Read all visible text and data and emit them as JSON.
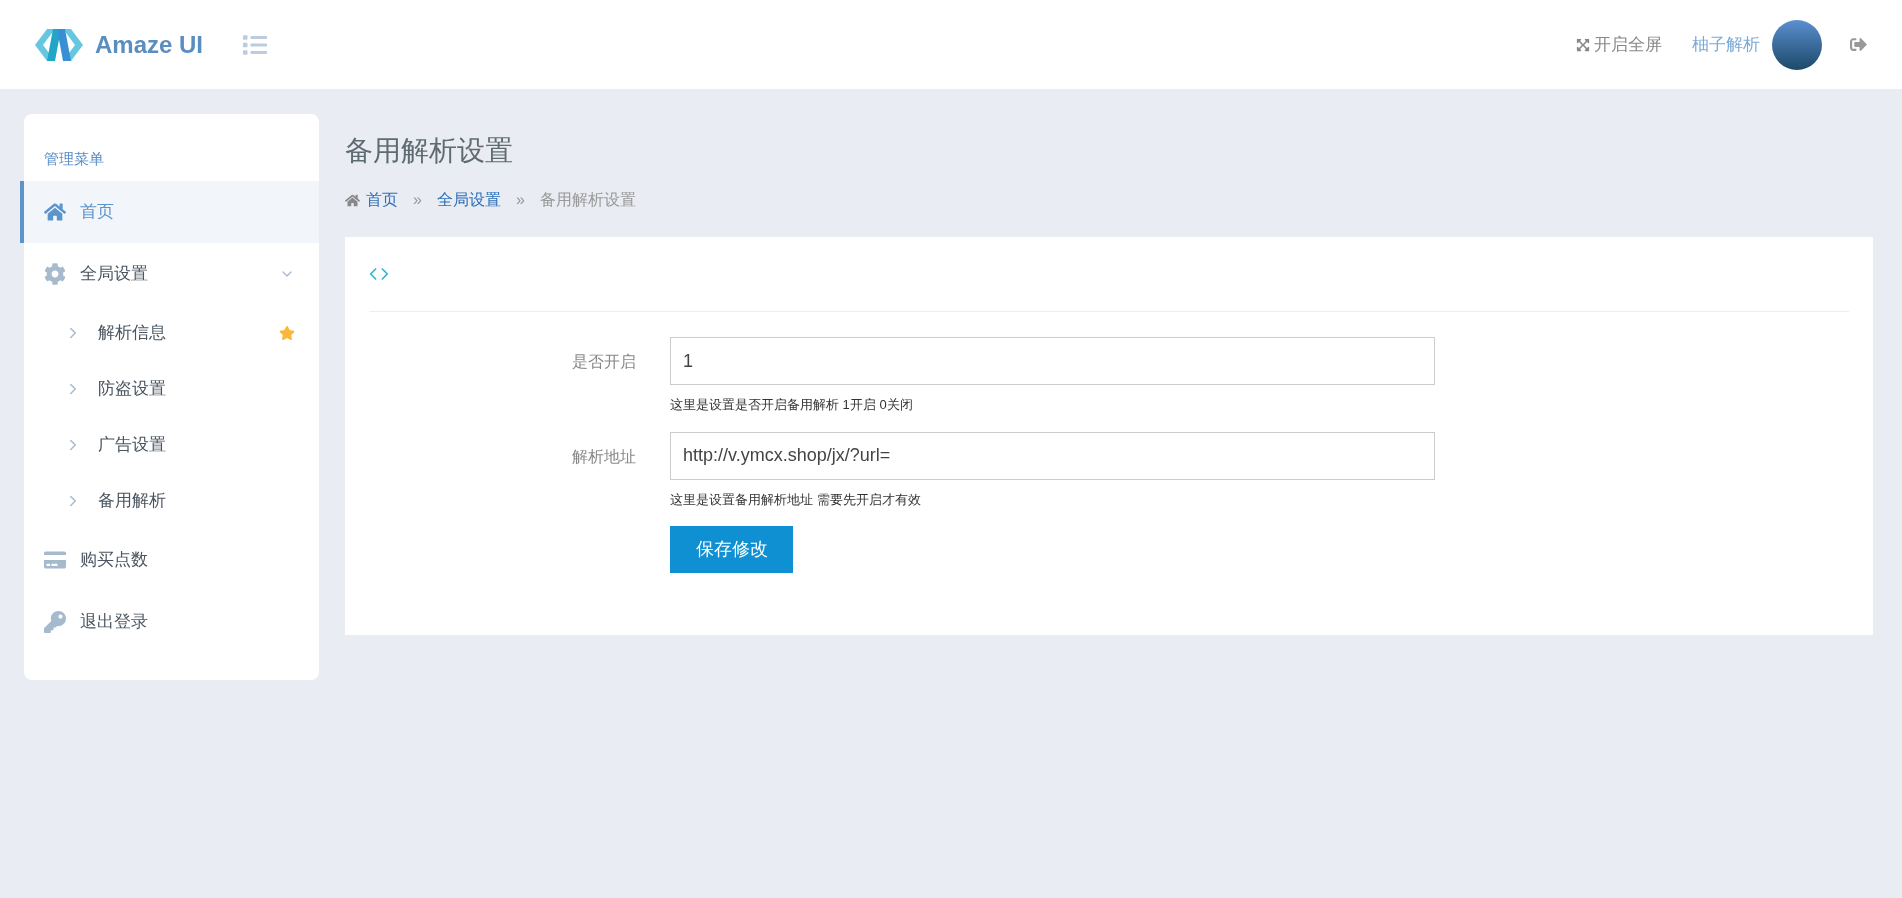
{
  "header": {
    "logo_text": "Amaze UI",
    "fullscreen": "开启全屏",
    "username": "柚子解析"
  },
  "sidebar": {
    "heading": "管理菜单",
    "items": [
      {
        "label": "首页",
        "selected": true
      },
      {
        "label": "全局设置",
        "selected": false,
        "expanded": true,
        "children": [
          {
            "label": "解析信息",
            "selected": false,
            "starred": true
          },
          {
            "label": "防盗设置",
            "selected": false,
            "starred": false
          },
          {
            "label": "广告设置",
            "selected": false,
            "starred": false
          },
          {
            "label": "备用解析",
            "selected": false,
            "starred": false
          }
        ]
      },
      {
        "label": "购买点数",
        "selected": false
      },
      {
        "label": "退出登录",
        "selected": false
      }
    ]
  },
  "page": {
    "title": "备用解析设置",
    "breadcrumb": [
      {
        "label": "首页",
        "kind": "link"
      },
      {
        "separator": "»",
        "label": "全局设置",
        "kind": "link"
      },
      {
        "separator": "»",
        "label": "备用解析设置",
        "kind": "current"
      }
    ]
  },
  "form": {
    "fields": [
      {
        "label": "是否开启",
        "value": "1",
        "help": "这里是设置是否开启备用解析 1开启 0关闭"
      },
      {
        "label": "解析地址",
        "value": "http://v.ymcx.shop/jx/?url=",
        "help": "这里是设置备用解析地址 需要先开启才有效"
      }
    ],
    "submit": "保存修改"
  }
}
